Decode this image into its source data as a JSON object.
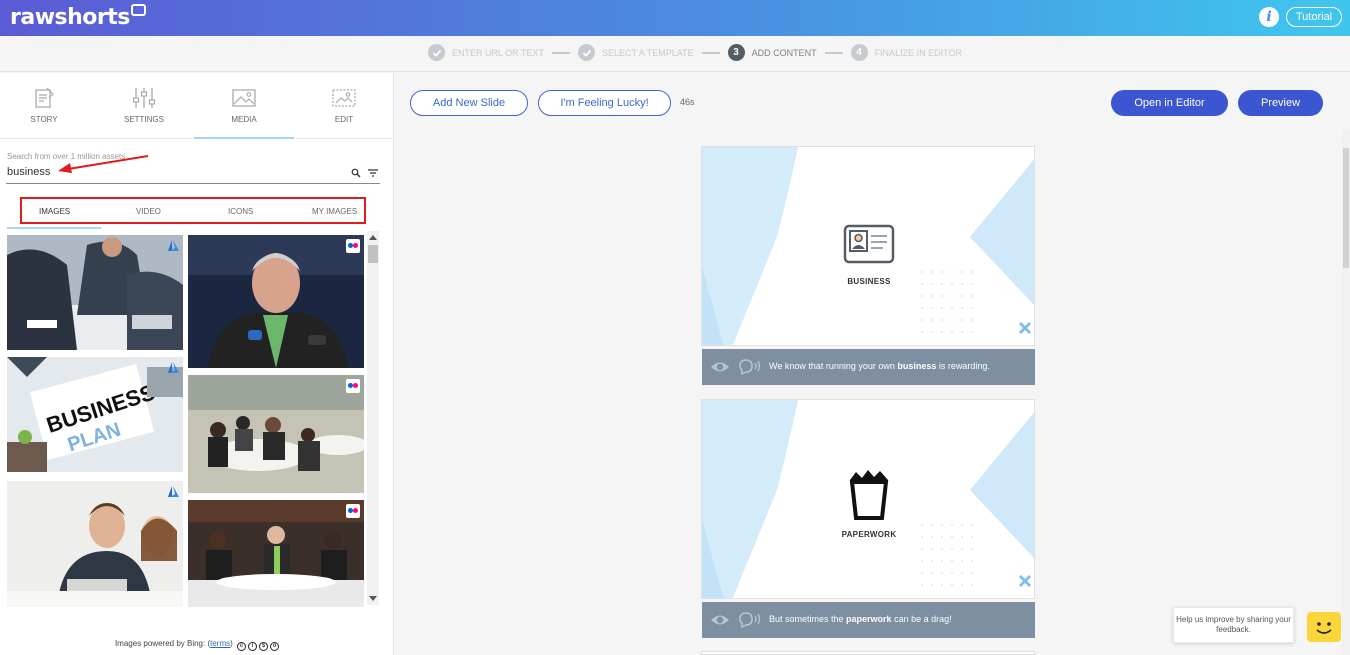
{
  "app": {
    "logo_text": "rawshorts",
    "tutorial_label": "Tutorial",
    "info_label": "i"
  },
  "steps": [
    {
      "number": "",
      "label": "ENTER URL OR TEXT",
      "state": "done"
    },
    {
      "number": "",
      "label": "SELECT A TEMPLATE",
      "state": "done"
    },
    {
      "number": "3",
      "label": "ADD CONTENT",
      "state": "active"
    },
    {
      "number": "4",
      "label": "FINALIZE IN EDITOR",
      "state": "todo"
    }
  ],
  "panel_tabs": [
    {
      "label": "STORY"
    },
    {
      "label": "SETTINGS"
    },
    {
      "label": "MEDIA"
    },
    {
      "label": "EDIT"
    }
  ],
  "search": {
    "hint": "Search from over 1 million assets",
    "value": "business"
  },
  "media_tabs": [
    {
      "label": "IMAGES"
    },
    {
      "label": "VIDEO"
    },
    {
      "label": "ICONS"
    },
    {
      "label": "MY IMAGES"
    }
  ],
  "powered_by": {
    "prefix": "Images powered by Bing: (",
    "link": "terms",
    "suffix": ")"
  },
  "toolbar": {
    "add_slide": "Add New Slide",
    "feeling_lucky": "I'm Feeling Lucky!",
    "duration": "46s",
    "open_editor": "Open in Editor",
    "preview": "Preview"
  },
  "slides": [
    {
      "title": "BUSINESS",
      "icon": "id-card-icon",
      "caption_pre": "We know that running your own ",
      "caption_bold": "business",
      "caption_post": " is rewarding."
    },
    {
      "title": "PAPERWORK",
      "icon": "paper-bin-icon",
      "caption_pre": "But sometimes the ",
      "caption_bold": "paperwork",
      "caption_post": " can be a drag!"
    }
  ],
  "feedback": {
    "text": "Help us improve by sharing your feedback."
  },
  "colors": {
    "accent": "#3b56d0",
    "highlight_box": "#e01b1b",
    "caption_bg": "#7d8fa0"
  }
}
